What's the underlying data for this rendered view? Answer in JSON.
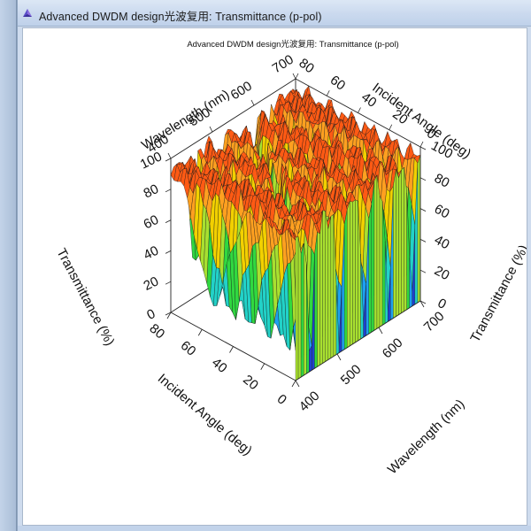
{
  "window": {
    "title": "Advanced DWDM design光波复用: Transmittance (p-pol)",
    "icon": "app-icon"
  },
  "chart_data": {
    "type": "surface-3d",
    "title": "Advanced DWDM design光波复用: Transmittance (p-pol)",
    "zlabel": "Transmittance (%)",
    "wavelength_label": "Wavelength (nm)",
    "angle_label": "Incident Angle (deg)",
    "wavelength_range": [
      400,
      700
    ],
    "angle_range": [
      0,
      90
    ],
    "z_range": [
      0,
      100
    ],
    "wavelength_ticks": [
      "400",
      "500",
      "600",
      "700"
    ],
    "angle_ticks": [
      "0",
      "20",
      "40",
      "60",
      "80"
    ],
    "z_ticks": [
      "0",
      "20",
      "40",
      "60",
      "80",
      "100"
    ],
    "colormap": [
      "#1f3fd0",
      "#1ea0f0",
      "#22d2c8",
      "#30d840",
      "#a8e030",
      "#f2d000",
      "#ffa020",
      "#ff5a14"
    ]
  }
}
